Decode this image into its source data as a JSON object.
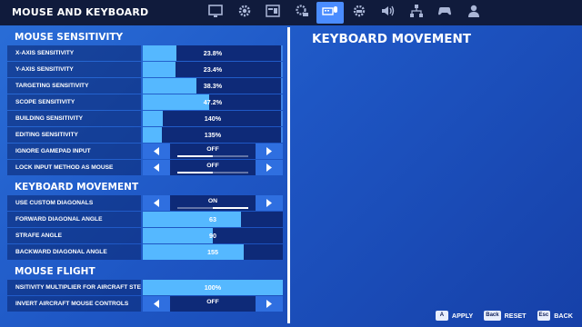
{
  "header": {
    "title": "MOUSE AND KEYBOARD"
  },
  "tabs": [
    {
      "icon": "monitor-icon"
    },
    {
      "icon": "gear-icon"
    },
    {
      "icon": "game-settings-icon"
    },
    {
      "icon": "gear-gamepad-icon"
    },
    {
      "icon": "mouse-keyboard-icon",
      "active": true
    },
    {
      "icon": "controller-gear-icon"
    },
    {
      "icon": "speaker-icon"
    },
    {
      "icon": "network-icon"
    },
    {
      "icon": "gamepad-icon"
    },
    {
      "icon": "account-icon"
    }
  ],
  "sections": {
    "mouse_sensitivity": {
      "title": "MOUSE SENSITIVITY",
      "rows": [
        {
          "label": "X-AXIS SENSITIVITY",
          "value": "23.8%",
          "fill": 0.238
        },
        {
          "label": "Y-AXIS SENSITIVITY",
          "value": "23.4%",
          "fill": 0.234
        },
        {
          "label": "TARGETING SENSITIVITY",
          "value": "38.3%",
          "fill": 0.383
        },
        {
          "label": "SCOPE SENSITIVITY",
          "value": "47.2%",
          "fill": 0.472
        },
        {
          "label": "BUILDING SENSITIVITY",
          "value": "140%",
          "fill": 0.14
        },
        {
          "label": "EDITING SENSITIVITY",
          "value": "135%",
          "fill": 0.135
        }
      ],
      "toggles": [
        {
          "label": "IGNORE GAMEPAD INPUT",
          "value": "OFF",
          "on_fraction": 0.5,
          "on_side": "left"
        },
        {
          "label": "LOCK INPUT METHOD AS MOUSE",
          "value": "OFF",
          "on_fraction": 0.5,
          "on_side": "left"
        }
      ]
    },
    "keyboard_movement": {
      "title": "KEYBOARD MOVEMENT",
      "toggle": {
        "label": "USE CUSTOM DIAGONALS",
        "value": "ON",
        "on_fraction": 0.5,
        "on_side": "right"
      },
      "rows": [
        {
          "label": "FORWARD DIAGONAL ANGLE",
          "value": "63",
          "fill": 0.7
        },
        {
          "label": "STRAFE ANGLE",
          "value": "90",
          "fill": 0.5
        },
        {
          "label": "BACKWARD DIAGONAL ANGLE",
          "value": "155",
          "fill": 0.72
        }
      ]
    },
    "mouse_flight": {
      "title": "MOUSE FLIGHT",
      "rows": [
        {
          "label": "NSITIVITY MULTIPLIER FOR AIRCRAFT STEERIN",
          "value": "100%",
          "fill": 1.0
        }
      ],
      "toggle": {
        "label": "INVERT AIRCRAFT MOUSE CONTROLS",
        "value": "OFF"
      }
    }
  },
  "right_panel": {
    "title": "KEYBOARD MOVEMENT"
  },
  "footer": {
    "apply": {
      "key": "A",
      "label": "APPLY"
    },
    "reset": {
      "key": "Back",
      "label": "RESET"
    },
    "back": {
      "key": "Esc",
      "label": "BACK"
    }
  },
  "colors": {
    "accent": "#55b8ff",
    "bar_bg": "#0e2a78",
    "topbar": "#101b3c"
  }
}
